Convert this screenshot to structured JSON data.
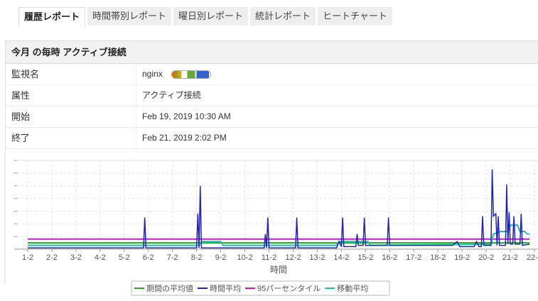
{
  "tabs": [
    "履歴レポート",
    "時間帯別レポート",
    "曜日別レポート",
    "統計レポート",
    "ヒートチャート"
  ],
  "panel": {
    "title": "今月 の毎時 アクティブ接続",
    "rows": [
      {
        "k": "監視名",
        "v": "nginx"
      },
      {
        "k": "属性",
        "v": "アクティブ接続"
      },
      {
        "k": "開始",
        "v": "Feb 19, 2019 10:30 AM"
      },
      {
        "k": "終了",
        "v": "Feb 21, 2019 2:02 PM"
      }
    ]
  },
  "chart_data": {
    "type": "line",
    "xlabel": "時間",
    "ylabel": "",
    "xlim": [
      1,
      22
    ],
    "ylim": [
      0,
      7
    ],
    "x_ticks": [
      "1-2",
      "2-2",
      "3-2",
      "4-2",
      "5-2",
      "6-2",
      "7-2",
      "8-2",
      "9-2",
      "10-2",
      "11-2",
      "12-2",
      "13-2",
      "14-2",
      "15-2",
      "16-2",
      "17-2",
      "18-2",
      "19-2",
      "20-2",
      "21-2",
      "22-2"
    ],
    "legend": "bottom",
    "series": [
      {
        "name": "期間の平均値",
        "color": "#22aa22",
        "points": [
          [
            1,
            0.5
          ],
          [
            21.8,
            0.5
          ]
        ]
      },
      {
        "name": "時間平均",
        "color": "#2222bb",
        "points": [
          [
            1,
            0.1
          ],
          [
            5.8,
            0.1
          ],
          [
            5.85,
            2.5
          ],
          [
            5.9,
            0.1
          ],
          [
            8.0,
            0.1
          ],
          [
            8.05,
            2.8
          ],
          [
            8.1,
            0.1
          ],
          [
            8.15,
            5.0
          ],
          [
            8.2,
            0.1
          ],
          [
            10.8,
            0.1
          ],
          [
            10.85,
            1.2
          ],
          [
            10.9,
            0.1
          ],
          [
            10.95,
            2.5
          ],
          [
            11.0,
            0.1
          ],
          [
            12.1,
            0.1
          ],
          [
            12.15,
            2.5
          ],
          [
            12.2,
            0.1
          ],
          [
            13.8,
            0.1
          ],
          [
            13.9,
            0.6
          ],
          [
            14.0,
            0.2
          ],
          [
            14.05,
            2.5
          ],
          [
            14.1,
            0.2
          ],
          [
            14.6,
            0.2
          ],
          [
            14.65,
            1.2
          ],
          [
            14.7,
            0.3
          ],
          [
            14.9,
            0.3
          ],
          [
            14.95,
            2.5
          ],
          [
            15.0,
            0.3
          ],
          [
            15.9,
            0.3
          ],
          [
            15.95,
            2.5
          ],
          [
            16.0,
            0.3
          ],
          [
            18.6,
            0.3
          ],
          [
            18.8,
            0.6
          ],
          [
            18.9,
            0.2
          ],
          [
            19.5,
            0.2
          ],
          [
            19.6,
            0.6
          ],
          [
            19.7,
            0.2
          ],
          [
            19.8,
            0.2
          ],
          [
            19.85,
            2.6
          ],
          [
            19.9,
            0.3
          ],
          [
            20.2,
            0.3
          ],
          [
            20.25,
            6.3
          ],
          [
            20.3,
            2.6
          ],
          [
            20.4,
            2.8
          ],
          [
            20.45,
            0.3
          ],
          [
            20.5,
            2.6
          ],
          [
            20.55,
            0.3
          ],
          [
            20.8,
            0.3
          ],
          [
            20.85,
            5.1
          ],
          [
            20.9,
            0.4
          ],
          [
            20.95,
            2.9
          ],
          [
            21.0,
            0.4
          ],
          [
            21.1,
            0.4
          ],
          [
            21.15,
            2.6
          ],
          [
            21.2,
            0.4
          ],
          [
            21.4,
            0.4
          ],
          [
            21.45,
            2.8
          ],
          [
            21.5,
            0.3
          ],
          [
            21.8,
            0.4
          ]
        ]
      },
      {
        "name": "95パーセンタイル",
        "color": "#bb22bb",
        "points": [
          [
            1,
            0.8
          ],
          [
            21.8,
            0.8
          ]
        ]
      },
      {
        "name": "移動平均",
        "color": "#22bbbb",
        "points": [
          [
            1,
            0.3
          ],
          [
            8.1,
            0.3
          ],
          [
            8.2,
            0.6
          ],
          [
            9.0,
            0.6
          ],
          [
            9.1,
            0.3
          ],
          [
            13.8,
            0.3
          ],
          [
            13.9,
            0.6
          ],
          [
            15.1,
            0.6
          ],
          [
            15.2,
            0.3
          ],
          [
            20.2,
            0.4
          ],
          [
            20.3,
            1.2
          ],
          [
            20.6,
            1.4
          ],
          [
            20.9,
            1.4
          ],
          [
            21.0,
            1.9
          ],
          [
            21.3,
            1.9
          ],
          [
            21.4,
            1.4
          ],
          [
            21.6,
            1.4
          ],
          [
            21.7,
            1.2
          ],
          [
            21.8,
            1.2
          ]
        ]
      }
    ]
  }
}
